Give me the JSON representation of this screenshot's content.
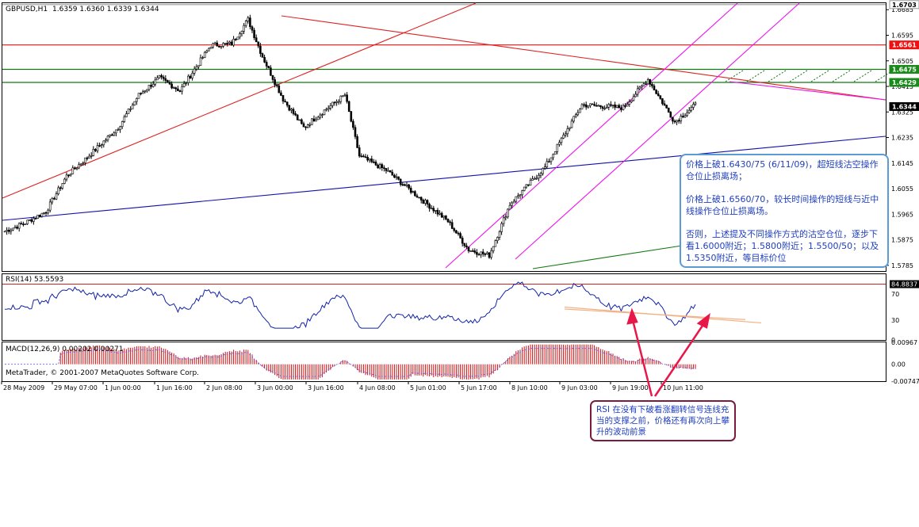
{
  "title_line": {
    "symbol": "GBPUSD,H1",
    "ohlc": "1.6359 1.6360 1.6339 1.6344"
  },
  "colors": {
    "bull": "#000000",
    "bear": "#000000",
    "resistance": "#ee1111",
    "support": "#117711",
    "channel": "#ee11ee",
    "trend_blue": "#1111aa",
    "trend_red": "#dd2222",
    "rsi": "#1122aa",
    "macd_hist": "#cc1111",
    "macd_signal": "#5555ff",
    "annotation_box": "#5b9bd5",
    "annotation_box2": "#7b1c3e"
  },
  "price_axis": {
    "ticks": [
      "1.6685",
      "1.6595",
      "1.6505",
      "1.6415",
      "1.6325",
      "1.6235",
      "1.6145",
      "1.6055",
      "1.5965",
      "1.5875",
      "1.5785"
    ],
    "tags": [
      {
        "label": "1.6703",
        "style": "gray"
      },
      {
        "label": "1.6561",
        "style": "red"
      },
      {
        "label": "1.6475",
        "style": "green"
      },
      {
        "label": "1.6429",
        "style": "green"
      },
      {
        "label": "1.6344",
        "style": "black"
      }
    ]
  },
  "rsi_panel": {
    "label": "RSI(14) 53.5593",
    "ticks": [
      "84.8837",
      "70",
      "30",
      "0"
    ]
  },
  "macd_panel": {
    "label": "MACD(12,26,9) 0.00202 0.00271",
    "ticks": [
      "0.00967",
      "0.00",
      "-0.00747"
    ],
    "copyright": "MetaTrader, © 2001-2007 MetaQuotes Software Corp."
  },
  "time_axis": {
    "labels": [
      "28 May 2009",
      "29 May 07:00",
      "1 Jun 00:00",
      "1 Jun 16:00",
      "2 Jun 08:00",
      "3 Jun 00:00",
      "3 Jun 16:00",
      "4 Jun 08:00",
      "5 Jun 01:00",
      "5 Jun 17:00",
      "8 Jun 10:00",
      "9 Jun 03:00",
      "9 Jun 19:00",
      "10 Jun 11:00"
    ]
  },
  "annotation_1": {
    "p1": "价格上破1.6430/75 (6/11/09)，超短线沽空操作仓位止损离场；",
    "p2": "价格上破1.6560/70，较长时间操作的短线与近中线操作仓位止损离场。",
    "p3": "否则，上述提及不同操作方式的沽空仓位，逐步下看1.6000附近；1.5800附近；1.5500/50；以及1.5350附近，等目标价位"
  },
  "annotation_2": {
    "text": "RSI 在没有下破看涨翻转信号连线充当的支撑之前，价格还有再次向上攀升的波动前景"
  },
  "chart_data": {
    "type": "candlestick",
    "symbol": "GBPUSD",
    "timeframe": "H1",
    "title": "GBPUSD,H1",
    "ylim": [
      1.5765,
      1.6708
    ],
    "horizontal_levels": [
      {
        "value": 1.6703,
        "color": "gray"
      },
      {
        "value": 1.6561,
        "color": "red"
      },
      {
        "value": 1.6475,
        "color": "green"
      },
      {
        "value": 1.6429,
        "color": "green"
      }
    ],
    "last_price": 1.6344,
    "close_path_keypoints": [
      {
        "bar": 0,
        "close": 1.5905
      },
      {
        "bar": 10,
        "close": 1.5935
      },
      {
        "bar": 20,
        "close": 1.5975
      },
      {
        "bar": 30,
        "close": 1.61
      },
      {
        "bar": 40,
        "close": 1.6165
      },
      {
        "bar": 55,
        "close": 1.627
      },
      {
        "bar": 65,
        "close": 1.6385
      },
      {
        "bar": 75,
        "close": 1.6445
      },
      {
        "bar": 85,
        "close": 1.64
      },
      {
        "bar": 100,
        "close": 1.656
      },
      {
        "bar": 110,
        "close": 1.6565
      },
      {
        "bar": 118,
        "close": 1.665
      },
      {
        "bar": 125,
        "close": 1.652
      },
      {
        "bar": 135,
        "close": 1.637
      },
      {
        "bar": 145,
        "close": 1.627
      },
      {
        "bar": 155,
        "close": 1.633
      },
      {
        "bar": 165,
        "close": 1.6385
      },
      {
        "bar": 172,
        "close": 1.617
      },
      {
        "bar": 185,
        "close": 1.612
      },
      {
        "bar": 200,
        "close": 1.603
      },
      {
        "bar": 215,
        "close": 1.594
      },
      {
        "bar": 225,
        "close": 1.584
      },
      {
        "bar": 235,
        "close": 1.582
      },
      {
        "bar": 245,
        "close": 1.6
      },
      {
        "bar": 262,
        "close": 1.613
      },
      {
        "bar": 280,
        "close": 1.635
      },
      {
        "bar": 300,
        "close": 1.634
      },
      {
        "bar": 312,
        "close": 1.644
      },
      {
        "bar": 325,
        "close": 1.629
      },
      {
        "bar": 335,
        "close": 1.635
      }
    ],
    "rsi": {
      "name": "RSI(14)",
      "last": 53.5593,
      "ylim": [
        0,
        100
      ],
      "levels": [
        30,
        70
      ]
    },
    "macd": {
      "name": "MACD(12,26,9)",
      "main": 0.00202,
      "signal": 0.00271,
      "ylim": [
        -0.00747,
        0.00967
      ]
    },
    "x_labels": [
      "28 May 2009",
      "29 May 07:00",
      "1 Jun 00:00",
      "1 Jun 16:00",
      "2 Jun 08:00",
      "3 Jun 00:00",
      "3 Jun 16:00",
      "4 Jun 08:00",
      "5 Jun 01:00",
      "5 Jun 17:00",
      "8 Jun 10:00",
      "9 Jun 03:00",
      "9 Jun 19:00",
      "10 Jun 11:00"
    ]
  }
}
